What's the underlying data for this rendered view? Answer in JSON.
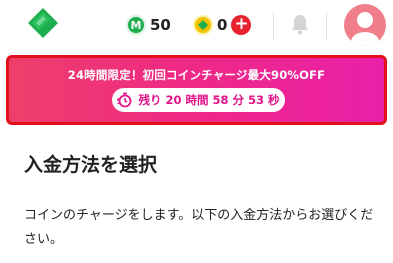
{
  "header": {
    "m_coin": {
      "badge": "M",
      "value": "50"
    },
    "g_coin": {
      "value": "0"
    },
    "plus_label": "+"
  },
  "promo": {
    "title": "24時間限定！初回コインチャージ最大90%OFF",
    "countdown": "残り 20 時間 58 分 53 秒"
  },
  "main": {
    "title": "入金方法を選択",
    "description": "コインのチャージをします。以下の入金方法からお選びください。"
  },
  "colors": {
    "brand_green": "#1fae4f",
    "promo_gradient_start": "#ee3f6a",
    "promo_gradient_end": "#ea1fa9",
    "promo_border": "#e2101a",
    "countdown_text": "#e2128a",
    "avatar": "#f07f8b"
  },
  "icons": [
    "logo-icon",
    "m-coin-icon",
    "gold-coin-icon",
    "plus-icon",
    "bell-icon",
    "avatar-icon",
    "timer-icon"
  ]
}
